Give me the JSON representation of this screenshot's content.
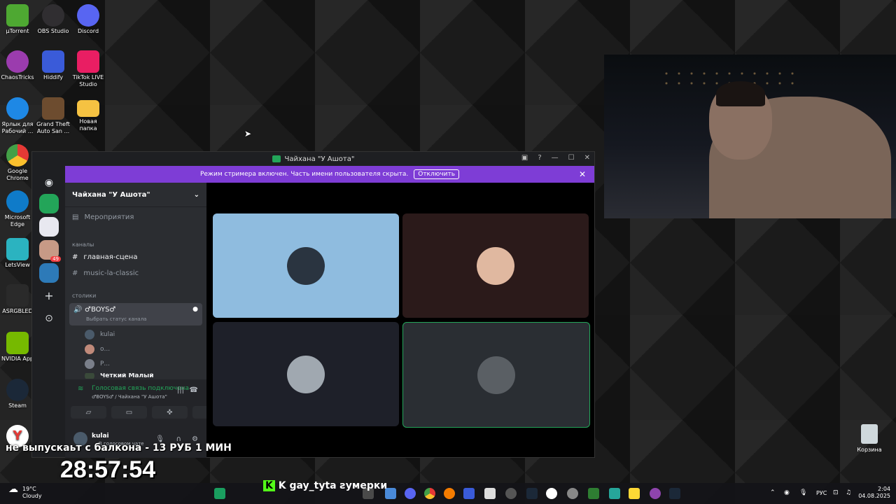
{
  "desktop": {
    "icons": [
      {
        "label": "µTorrent",
        "color": "#4ea832"
      },
      {
        "label": "OBS Studio",
        "color": "#302e31"
      },
      {
        "label": "Discord",
        "color": "#5865f2"
      },
      {
        "label": "ChaosTricks",
        "color": "#9b3cae"
      },
      {
        "label": "Hiddify",
        "color": "#3a5bd9"
      },
      {
        "label": "TikTok LIVE Studio",
        "color": "#e91e63"
      },
      {
        "label": "Ярлык для Рабочий ...",
        "color": "#1e88e5"
      },
      {
        "label": "Grand Theft Auto San ...",
        "color": "#6d4c2f"
      },
      {
        "label": "Новая папка",
        "color": "#f5c242"
      },
      {
        "label": "Google Chrome",
        "color": "#e53935"
      },
      {
        "label": "Microsoft Edge",
        "color": "#0f7bc9"
      },
      {
        "label": "LetsView",
        "color": "#2bb3c0"
      },
      {
        "label": "ASRGBLED",
        "color": "#2a2a2a"
      },
      {
        "label": "NVIDIA App",
        "color": "#76b900"
      },
      {
        "label": "Steam",
        "color": "#1b2838"
      }
    ],
    "trash_label": "Корзина"
  },
  "discord": {
    "window_title": "Чайхана \"У Ашота\"",
    "banner_text": "Режим стримера включен. Часть имени пользователя скрыта.",
    "banner_button": "Отключить",
    "server_name": "Чайхана \"У Ашота\"",
    "events_label": "Мероприятия",
    "channels_category": "каналы",
    "channels": [
      "главная-сцена",
      "music-la-classic"
    ],
    "voice_category": "столики",
    "voice_channel": "♂BOYS♂",
    "voice_status": "Выбрать статус канала",
    "voice_users": [
      "kulai",
      "о...",
      "Р...",
      "Четкий Малый"
    ],
    "server_badge": "49",
    "voice_connected": "Голосовая связь подключена",
    "voice_location": "♂BOYS♂ / Чайхана \"У Ашота\"",
    "current_user": "kulai",
    "current_user_status": "В голосовом чате",
    "tile_colors": [
      "#8fbcdf",
      "#2b1a1a",
      "#1e2029",
      "#2a2e33"
    ]
  },
  "overlay": {
    "ticker": "не выпускаьт с балкона - 13 РУБ 1 МИН",
    "timer": "28:57:54",
    "stream_label": "K gay_tyta ƨумерки"
  },
  "taskbar": {
    "weather_temp": "19°C",
    "weather_desc": "Cloudy",
    "lang": "РУС",
    "time": "2:04",
    "date": "04.08.2025"
  }
}
